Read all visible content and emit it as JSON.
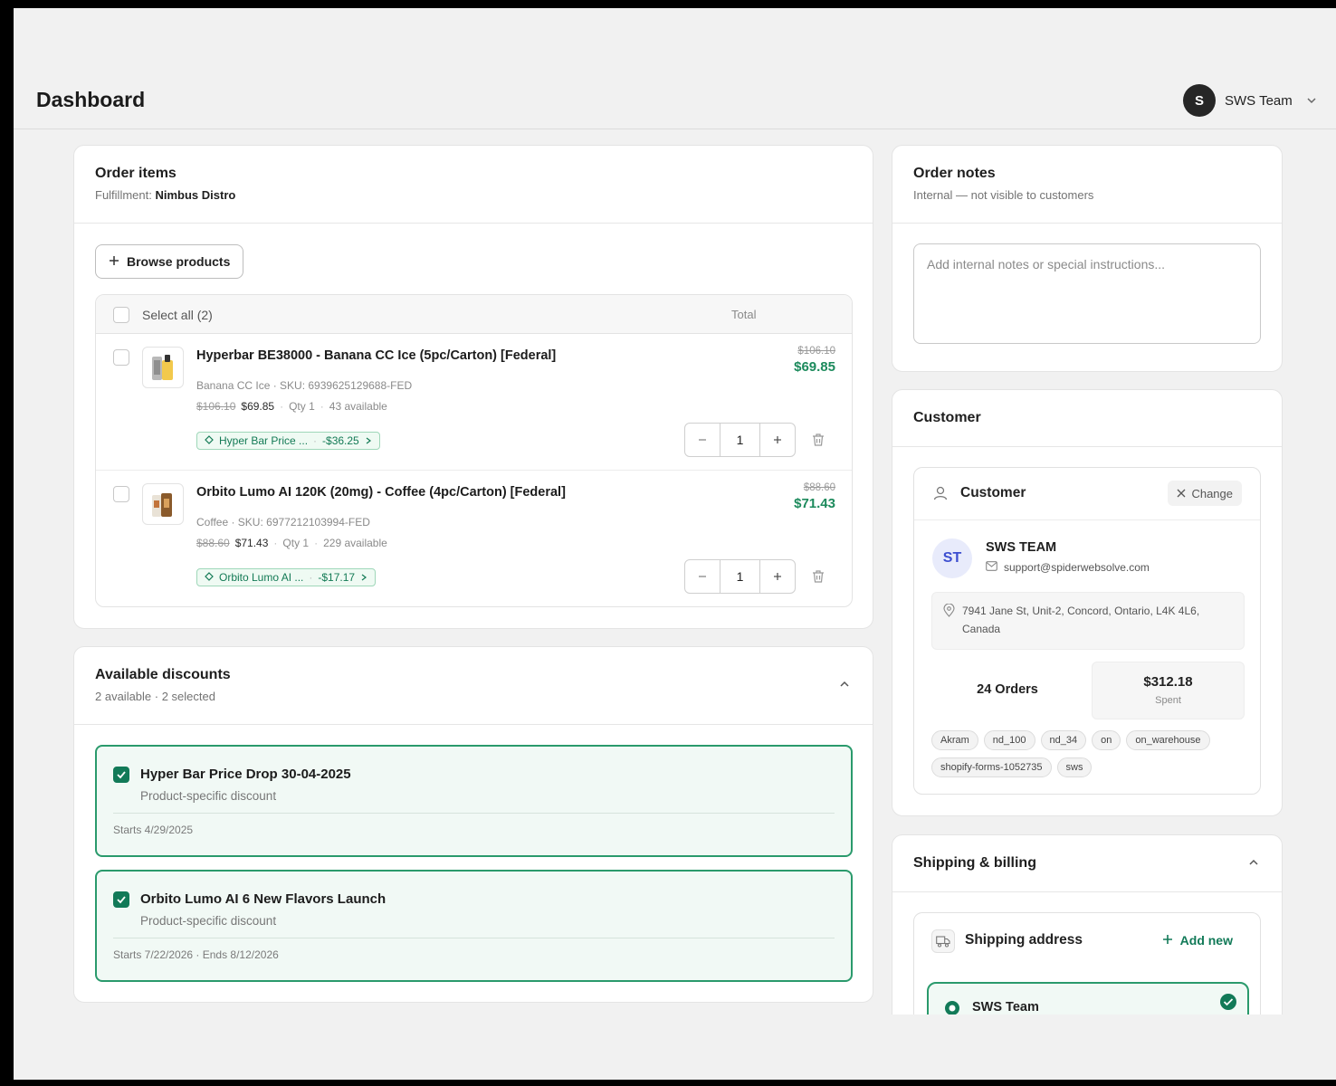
{
  "header": {
    "title": "Dashboard",
    "user": {
      "initial": "S",
      "name": "SWS Team"
    }
  },
  "order_items": {
    "title": "Order items",
    "fulfillment_label": "Fulfillment:",
    "fulfillment_value": "Nimbus Distro",
    "browse_label": "Browse products",
    "select_all_label": "Select all (2)",
    "total_header": "Total",
    "items": [
      {
        "name": "Hyperbar BE38000 - Banana CC Ice (5pc/Carton) [Federal]",
        "meta": "Banana CC Ice · SKU: 6939625129688-FED",
        "old_price": "$106.10",
        "new_price": "$69.85",
        "qty_label": "Qty 1",
        "available": "43 available",
        "discount_name": "Hyper Bar Price ...",
        "discount_amount": "-$36.25",
        "total_old": "$106.10",
        "total_new": "$69.85",
        "quantity": "1"
      },
      {
        "name": "Orbito Lumo AI 120K (20mg) - Coffee (4pc/Carton) [Federal]",
        "meta": "Coffee · SKU: 6977212103994-FED",
        "old_price": "$88.60",
        "new_price": "$71.43",
        "qty_label": "Qty 1",
        "available": "229 available",
        "discount_name": "Orbito Lumo AI ...",
        "discount_amount": "-$17.17",
        "total_old": "$88.60",
        "total_new": "$71.43",
        "quantity": "1"
      }
    ]
  },
  "discounts": {
    "title": "Available discounts",
    "subtitle": "2 available · 2 selected",
    "items": [
      {
        "name": "Hyper Bar Price Drop 30-04-2025",
        "type": "Product-specific discount",
        "dates": "Starts 4/29/2025"
      },
      {
        "name": "Orbito Lumo AI 6 New Flavors Launch",
        "type": "Product-specific discount",
        "dates": "Starts 7/22/2026 · Ends 8/12/2026"
      }
    ]
  },
  "order_notes": {
    "title": "Order notes",
    "subtitle": "Internal — not visible to customers",
    "placeholder": "Add internal notes or special instructions..."
  },
  "customer": {
    "section_title": "Customer",
    "inner_title": "Customer",
    "change_label": "Change",
    "initials": "ST",
    "name": "SWS TEAM",
    "email": "support@spiderwebsolve.com",
    "address_line1": "7941 Jane St, Unit-2, Concord, Ontario, L4K 4L6,",
    "address_line2": "Canada",
    "orders": "24 Orders",
    "spent_value": "$312.18",
    "spent_label": "Spent",
    "tags": [
      "Akram",
      "nd_100",
      "nd_34",
      "on",
      "on_warehouse",
      "shopify-forms-1052735",
      "sws"
    ]
  },
  "shipping": {
    "title": "Shipping & billing",
    "address_title": "Shipping address",
    "add_new_label": "Add new",
    "selected_name": "SWS Team"
  },
  "colors": {
    "accent_green": "#127a58",
    "price_green": "#1c8a5c",
    "discount_border": "#2a9a6c"
  }
}
